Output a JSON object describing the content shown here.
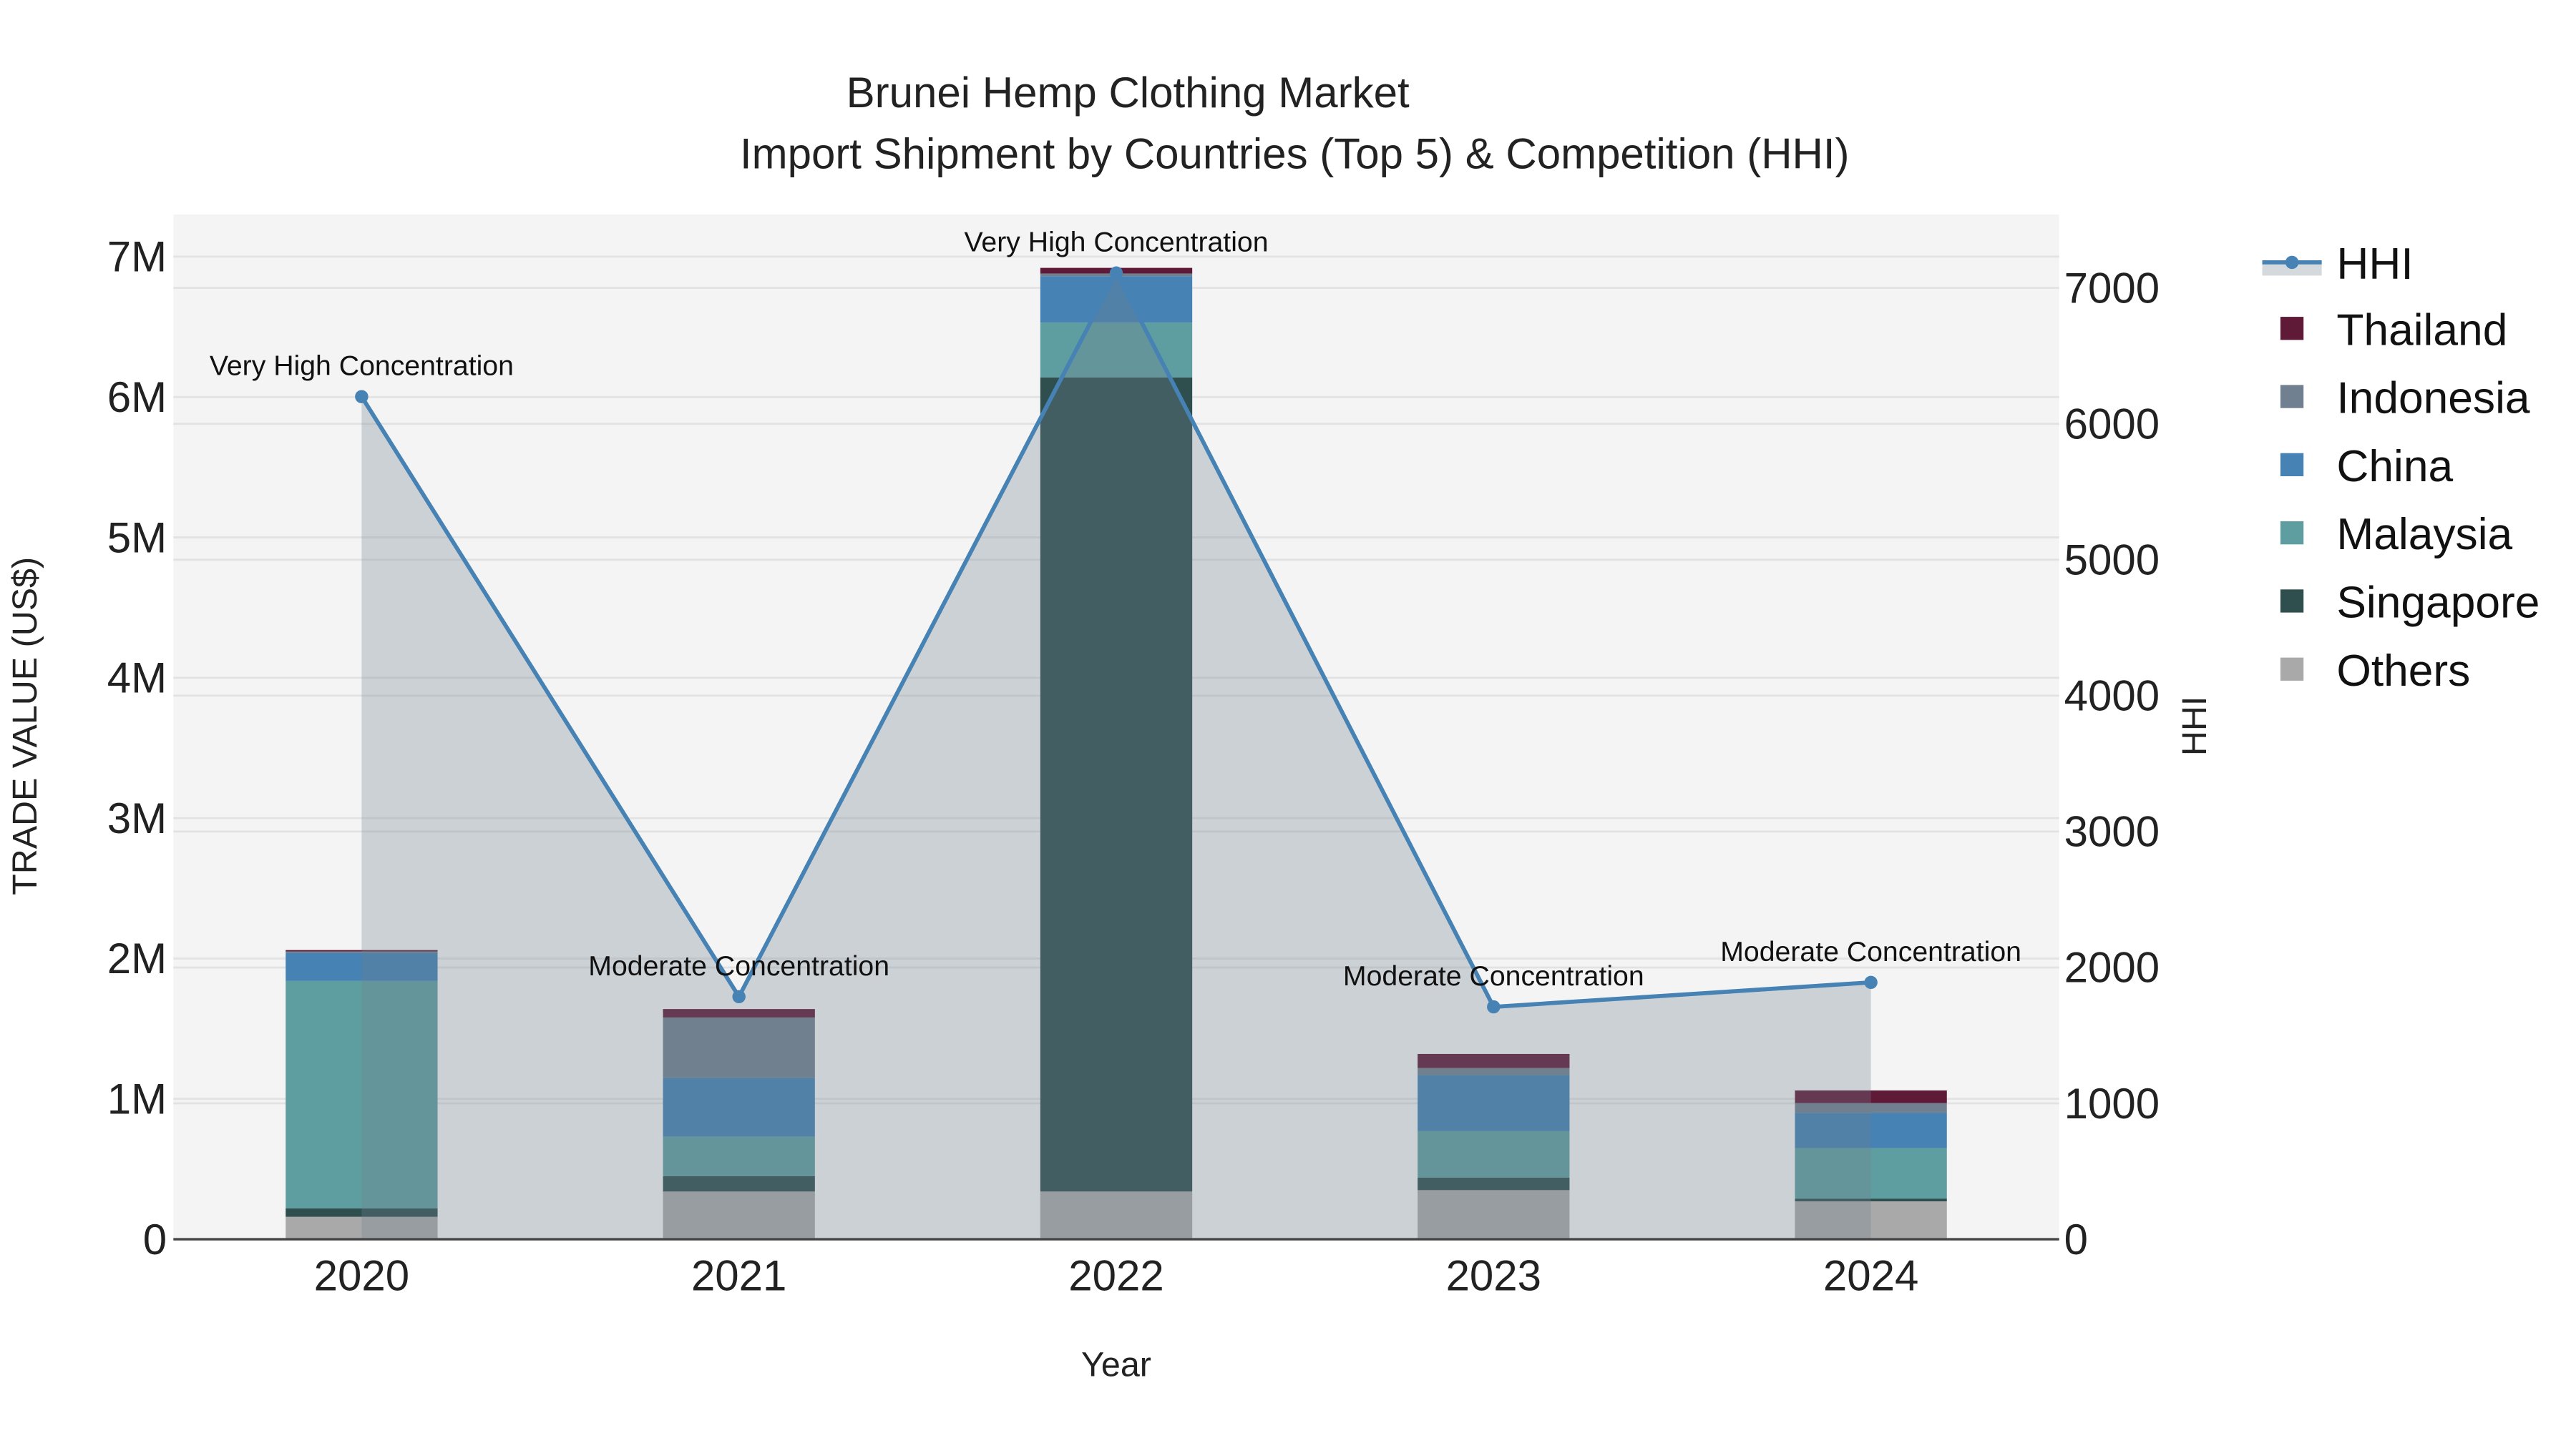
{
  "chart_data": {
    "type": "bar",
    "title": "Brunei Hemp Clothing Market",
    "subtitle": "Import Shipment by Countries (Top 5) & Competition (HHI)",
    "xlabel": "Year",
    "ylabel": "TRADE VALUE (US$)",
    "y2label": "HHI",
    "ylim": [
      0,
      7300000
    ],
    "y2lim": [
      0,
      7540
    ],
    "yticks": [
      0,
      1000000,
      2000000,
      3000000,
      4000000,
      5000000,
      6000000,
      7000000
    ],
    "ytick_labels": [
      "0",
      "1M",
      "2M",
      "3M",
      "4M",
      "5M",
      "6M",
      "7M"
    ],
    "y2ticks": [
      0,
      1000,
      2000,
      3000,
      4000,
      5000,
      6000,
      7000
    ],
    "y2tick_labels": [
      "0",
      "1000",
      "2000",
      "3000",
      "4000",
      "5000",
      "6000",
      "7000"
    ],
    "categories": [
      "2020",
      "2021",
      "2022",
      "2023",
      "2024"
    ],
    "stacked": true,
    "grid": true,
    "legend_position": "right",
    "series": [
      {
        "name": "Others",
        "color": "#a9a9a9",
        "values": [
          160000,
          340000,
          340000,
          350000,
          270000
        ]
      },
      {
        "name": "Singapore",
        "color": "#2f4f4f",
        "values": [
          60000,
          110000,
          5800000,
          90000,
          20000
        ]
      },
      {
        "name": "Malaysia",
        "color": "#5f9ea0",
        "values": [
          1620000,
          280000,
          390000,
          330000,
          360000
        ]
      },
      {
        "name": "China",
        "color": "#4682b4",
        "values": [
          200000,
          420000,
          330000,
          400000,
          250000
        ]
      },
      {
        "name": "Indonesia",
        "color": "#708090",
        "values": [
          10000,
          430000,
          20000,
          50000,
          70000
        ]
      },
      {
        "name": "Thailand",
        "color": "#5f1a37",
        "values": [
          10000,
          60000,
          40000,
          100000,
          90000
        ]
      }
    ],
    "hhi": {
      "name": "HHI",
      "color": "#4682b4",
      "values": [
        6200,
        1785,
        7110,
        1710,
        1890
      ],
      "annotations": [
        "Very High Concentration",
        "Moderate Concentration",
        "Very High Concentration",
        "Moderate Concentration",
        "Moderate Concentration"
      ]
    },
    "legend": [
      "HHI",
      "Thailand",
      "Indonesia",
      "China",
      "Malaysia",
      "Singapore",
      "Others"
    ]
  }
}
